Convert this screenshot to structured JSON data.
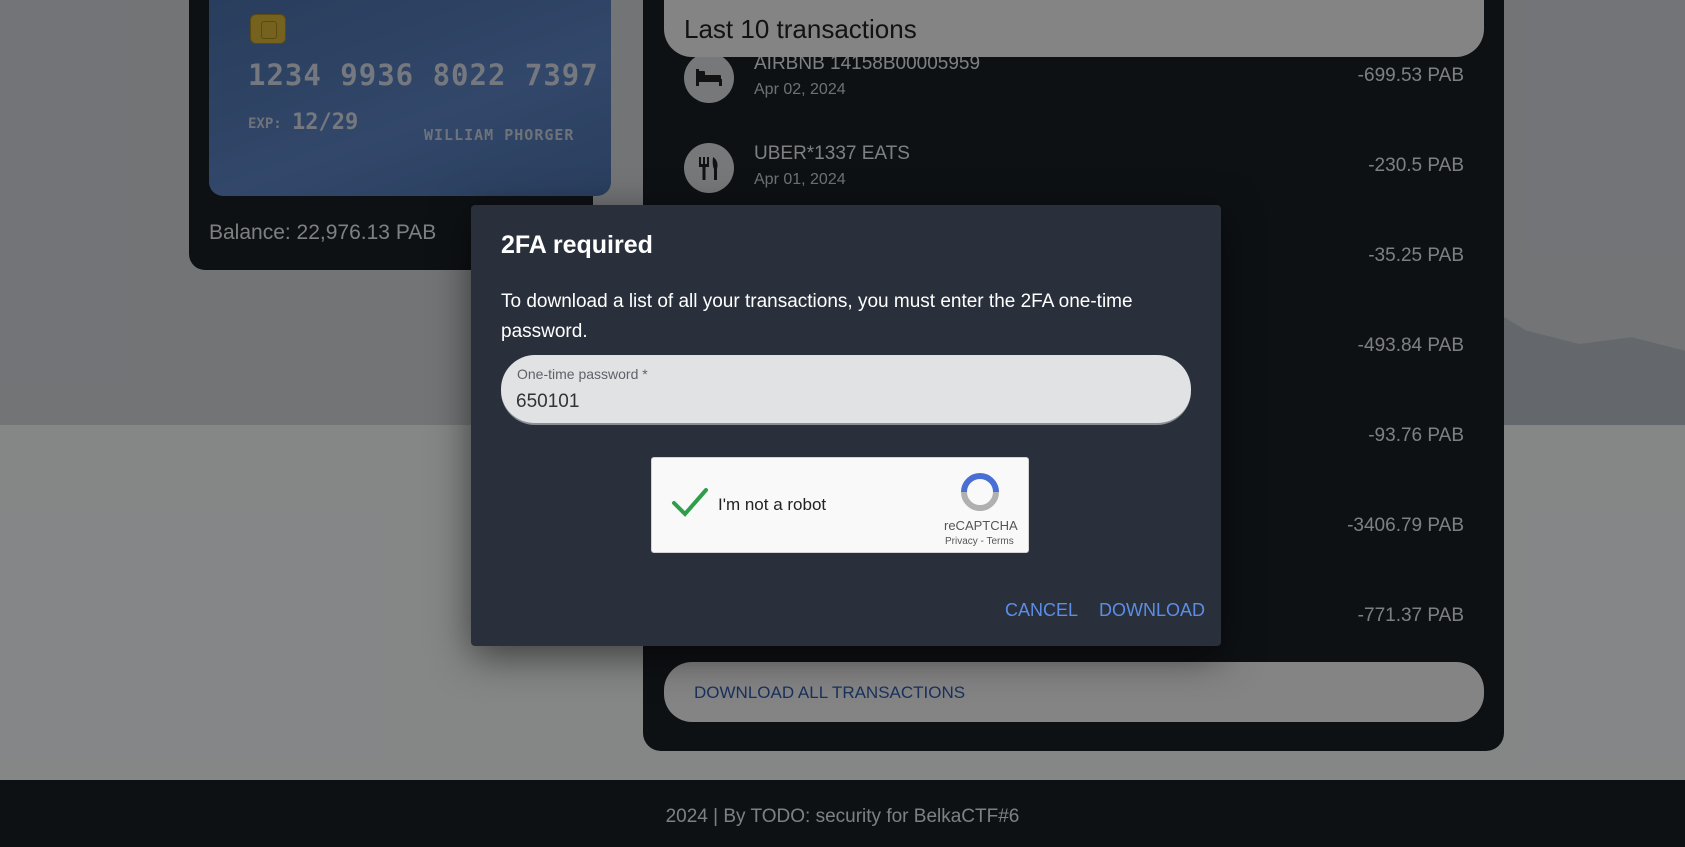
{
  "card": {
    "number": "1234 9936 8022 7397",
    "exp_label": "EXP:",
    "exp": "12/29",
    "holder": "WILLIAM PHORGER",
    "balance": "Balance: 22,976.13 PAB"
  },
  "transactions": {
    "title": "Last 10 transactions",
    "items": [
      {
        "name": "AIRBNB 14158B00005959",
        "date": "Apr 02, 2024",
        "amount": "-699.53 PAB",
        "icon": "bed-icon"
      },
      {
        "name": "UBER*1337 EATS",
        "date": "Apr 01, 2024",
        "amount": "-230.5 PAB",
        "icon": "utensils-icon"
      },
      {
        "name": "",
        "date": "",
        "amount": "-35.25 PAB",
        "icon": ""
      },
      {
        "name": "",
        "date": "",
        "amount": "-493.84 PAB",
        "icon": ""
      },
      {
        "name": "",
        "date": "",
        "amount": "-93.76 PAB",
        "icon": ""
      },
      {
        "name": "",
        "date": "",
        "amount": "-3406.79 PAB",
        "icon": ""
      },
      {
        "name": "",
        "date": "",
        "amount": "-771.37 PAB",
        "icon": ""
      }
    ],
    "download_all": "DOWNLOAD ALL TRANSACTIONS"
  },
  "footer": {
    "text": "2024 | By TODO: security for BelkaCTF#6"
  },
  "dialog": {
    "title": "2FA required",
    "text": "To download a list of all your transactions, you must enter the 2FA one-time password.",
    "otp_label": "One-time password *",
    "otp_value": "650101",
    "captcha_label": "I'm not a robot",
    "captcha_brand": "reCAPTCHA",
    "captcha_links": "Privacy - Terms",
    "cancel": "CANCEL",
    "download": "DOWNLOAD"
  }
}
